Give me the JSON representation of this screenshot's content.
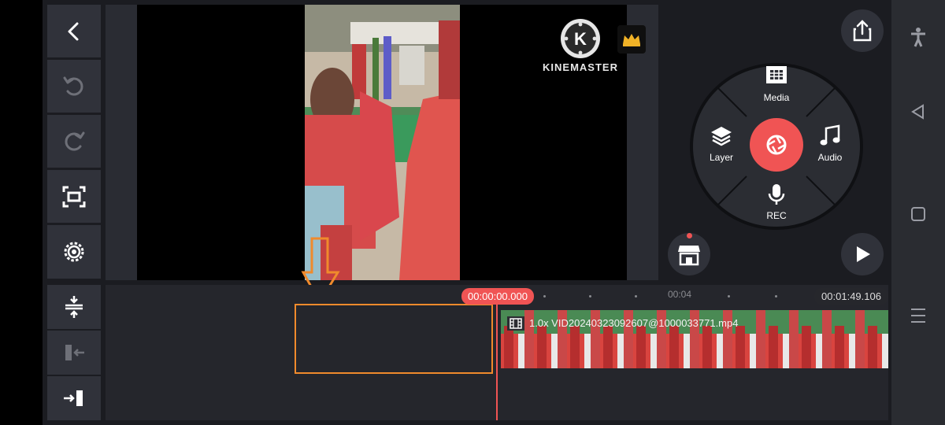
{
  "toolbar_left": {
    "back": "back-icon",
    "undo": "undo-icon",
    "redo": "redo-icon",
    "fit": "fit-screen-icon",
    "settings": "settings-icon"
  },
  "watermark": {
    "brand": "KINEMASTER",
    "premium": "crown-icon"
  },
  "radial_menu": {
    "media_label": "Media",
    "layer_label": "Layer",
    "audio_label": "Audio",
    "rec_label": "REC",
    "capture": "camera-aperture-icon"
  },
  "buttons": {
    "export": "share-export-icon",
    "store": "store-icon",
    "play": "play-icon"
  },
  "timeline": {
    "current_time": "00:00:00.000",
    "marker_label": "00:04",
    "total_duration": "00:01:49.106",
    "clip_label": "1.0x VID20240323092607@1000033771.mp4",
    "tools": [
      "split-icon",
      "trim-left-icon",
      "trim-right-icon"
    ]
  },
  "colors": {
    "accent": "#f05454",
    "highlight": "#f08a2c",
    "panel": "#30323a",
    "background": "#1b1c21"
  }
}
